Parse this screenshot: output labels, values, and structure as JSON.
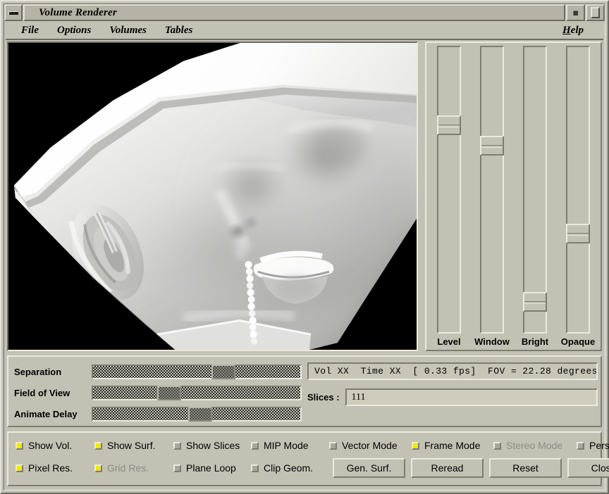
{
  "window": {
    "title": "Volume Renderer",
    "minimize_icon": "minimize-icon",
    "restore_icon": "restore-icon",
    "maximize_icon": "maximize-icon"
  },
  "menubar": {
    "items": [
      {
        "label": "File"
      },
      {
        "label": "Options"
      },
      {
        "label": "Volumes"
      },
      {
        "label": "Tables"
      }
    ],
    "help": {
      "mnemonic": "H",
      "rest": "elp"
    }
  },
  "render": {
    "alt": "Volume rendered grayscale CT head scan on black background",
    "background": "#000000"
  },
  "vertical_sliders": [
    {
      "name": "level",
      "label": "Level",
      "value_pct": 25,
      "thumb_top_pct": 24
    },
    {
      "name": "window",
      "label": "Window",
      "value_pct": 32,
      "thumb_top_pct": 31
    },
    {
      "name": "bright",
      "label": "Bright",
      "value_pct": 88,
      "thumb_top_pct": 86
    },
    {
      "name": "opaque",
      "label": "Opaque",
      "value_pct": 64,
      "thumb_top_pct": 62
    }
  ],
  "horizontal_sliders": [
    {
      "name": "separation",
      "label": "Separation",
      "thumb_left_pct": 57,
      "enabled": false
    },
    {
      "name": "field-of-view",
      "label": "Field of View",
      "thumb_left_pct": 31,
      "enabled": false
    },
    {
      "name": "animate-delay",
      "label": "Animate Delay",
      "thumb_left_pct": 46,
      "enabled": false
    }
  ],
  "info": {
    "status_text": "Vol XX  Time XX  [ 0.33 fps]  FOV = 22.28 degrees",
    "slices_label": "Slices :",
    "slices_value": "111"
  },
  "toggles_row1": [
    {
      "name": "show-vol",
      "label": "Show Vol.",
      "checked": true,
      "enabled": true
    },
    {
      "name": "show-surf",
      "label": "Show Surf.",
      "checked": true,
      "enabled": true
    },
    {
      "name": "show-slices",
      "label": "Show Slices",
      "checked": false,
      "enabled": true
    },
    {
      "name": "mip-mode",
      "label": "MIP Mode",
      "checked": false,
      "enabled": true
    },
    {
      "name": "vector-mode",
      "label": "Vector Mode",
      "checked": false,
      "enabled": true
    },
    {
      "name": "frame-mode",
      "label": "Frame Mode",
      "checked": true,
      "enabled": true
    },
    {
      "name": "stereo-mode",
      "label": "Stereo Mode",
      "checked": false,
      "enabled": false
    },
    {
      "name": "persp-mode",
      "label": "Persp. Mode",
      "checked": false,
      "enabled": true
    }
  ],
  "toggles_row2": [
    {
      "name": "pixel-res",
      "label": "Pixel Res.",
      "checked": true,
      "enabled": true
    },
    {
      "name": "grid-res",
      "label": "Grid Res.",
      "checked": true,
      "enabled": false
    },
    {
      "name": "plane-loop",
      "label": "Plane Loop",
      "checked": false,
      "enabled": true
    },
    {
      "name": "clip-geom",
      "label": "Clip Geom.",
      "checked": false,
      "enabled": true
    }
  ],
  "action_buttons": [
    {
      "name": "gen-surf",
      "label": "Gen. Surf."
    },
    {
      "name": "reread",
      "label": "Reread"
    },
    {
      "name": "reset",
      "label": "Reset"
    },
    {
      "name": "close",
      "label": "Close"
    }
  ],
  "colors": {
    "face": "#c3c0b4",
    "top_shadow": "#eceade",
    "bottom_shadow": "#7e7c72",
    "title_face": "#b6b3a6",
    "text_field": "#cfccbd",
    "toggle_on": "#f2e800",
    "canvas": "#000000"
  }
}
